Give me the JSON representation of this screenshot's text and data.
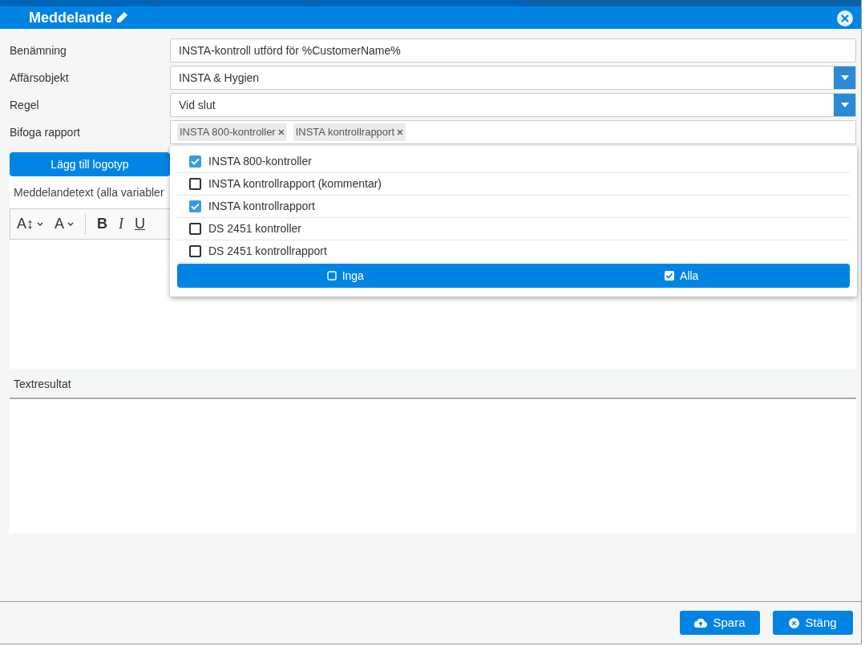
{
  "window": {
    "title": "Meddelande"
  },
  "fields": [
    {
      "kind": "text",
      "label": "Benämning",
      "value": "INSTA-kontroll utförd för %CustomerName%"
    },
    {
      "kind": "select",
      "label": "Affärsobjekt",
      "value": "INSTA & Hygien"
    },
    {
      "kind": "select",
      "label": "Regel",
      "value": "Vid slut"
    },
    {
      "kind": "tags",
      "label": "Bifoga rapport",
      "tags": [
        "INSTA 800-kontroller",
        "INSTA kontrollrapport"
      ]
    }
  ],
  "logo_button": "Lägg till logotyp",
  "message_label": "Meddelandetext (alla variabler",
  "toolbar": [
    {
      "kind": "size",
      "label": "A↕"
    },
    {
      "kind": "format",
      "label": "A"
    },
    {
      "kind": "bold",
      "label": "B"
    },
    {
      "kind": "italic",
      "label": "I"
    },
    {
      "kind": "underline",
      "label": "U"
    }
  ],
  "dropdown": {
    "options": [
      {
        "label": "INSTA 800-kontroller",
        "checked": true
      },
      {
        "label": "INSTA kontrollrapport (kommentar)",
        "checked": false
      },
      {
        "label": "INSTA kontrollrapport",
        "checked": true
      },
      {
        "label": "DS 2451 kontroller",
        "checked": false
      },
      {
        "label": "DS 2451 kontrollrapport",
        "checked": false
      }
    ],
    "buttons": [
      {
        "kind": "none",
        "label": "Inga"
      },
      {
        "kind": "all",
        "label": "Alla"
      }
    ]
  },
  "result_label": "Textresultat",
  "footer_buttons": [
    {
      "kind": "save",
      "label": "Spara"
    },
    {
      "kind": "close",
      "label": "Stäng"
    }
  ]
}
